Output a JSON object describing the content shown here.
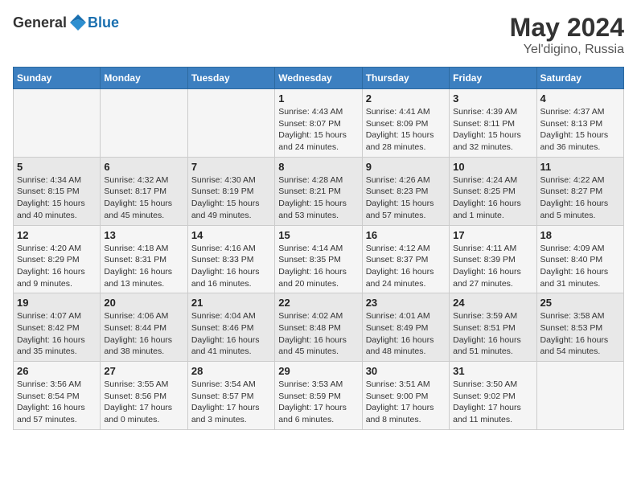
{
  "header": {
    "logo_general": "General",
    "logo_blue": "Blue",
    "month": "May 2024",
    "location": "Yel'digino, Russia"
  },
  "weekdays": [
    "Sunday",
    "Monday",
    "Tuesday",
    "Wednesday",
    "Thursday",
    "Friday",
    "Saturday"
  ],
  "weeks": [
    [
      {
        "day": "",
        "info": ""
      },
      {
        "day": "",
        "info": ""
      },
      {
        "day": "",
        "info": ""
      },
      {
        "day": "1",
        "info": "Sunrise: 4:43 AM\nSunset: 8:07 PM\nDaylight: 15 hours\nand 24 minutes."
      },
      {
        "day": "2",
        "info": "Sunrise: 4:41 AM\nSunset: 8:09 PM\nDaylight: 15 hours\nand 28 minutes."
      },
      {
        "day": "3",
        "info": "Sunrise: 4:39 AM\nSunset: 8:11 PM\nDaylight: 15 hours\nand 32 minutes."
      },
      {
        "day": "4",
        "info": "Sunrise: 4:37 AM\nSunset: 8:13 PM\nDaylight: 15 hours\nand 36 minutes."
      }
    ],
    [
      {
        "day": "5",
        "info": "Sunrise: 4:34 AM\nSunset: 8:15 PM\nDaylight: 15 hours\nand 40 minutes."
      },
      {
        "day": "6",
        "info": "Sunrise: 4:32 AM\nSunset: 8:17 PM\nDaylight: 15 hours\nand 45 minutes."
      },
      {
        "day": "7",
        "info": "Sunrise: 4:30 AM\nSunset: 8:19 PM\nDaylight: 15 hours\nand 49 minutes."
      },
      {
        "day": "8",
        "info": "Sunrise: 4:28 AM\nSunset: 8:21 PM\nDaylight: 15 hours\nand 53 minutes."
      },
      {
        "day": "9",
        "info": "Sunrise: 4:26 AM\nSunset: 8:23 PM\nDaylight: 15 hours\nand 57 minutes."
      },
      {
        "day": "10",
        "info": "Sunrise: 4:24 AM\nSunset: 8:25 PM\nDaylight: 16 hours\nand 1 minute."
      },
      {
        "day": "11",
        "info": "Sunrise: 4:22 AM\nSunset: 8:27 PM\nDaylight: 16 hours\nand 5 minutes."
      }
    ],
    [
      {
        "day": "12",
        "info": "Sunrise: 4:20 AM\nSunset: 8:29 PM\nDaylight: 16 hours\nand 9 minutes."
      },
      {
        "day": "13",
        "info": "Sunrise: 4:18 AM\nSunset: 8:31 PM\nDaylight: 16 hours\nand 13 minutes."
      },
      {
        "day": "14",
        "info": "Sunrise: 4:16 AM\nSunset: 8:33 PM\nDaylight: 16 hours\nand 16 minutes."
      },
      {
        "day": "15",
        "info": "Sunrise: 4:14 AM\nSunset: 8:35 PM\nDaylight: 16 hours\nand 20 minutes."
      },
      {
        "day": "16",
        "info": "Sunrise: 4:12 AM\nSunset: 8:37 PM\nDaylight: 16 hours\nand 24 minutes."
      },
      {
        "day": "17",
        "info": "Sunrise: 4:11 AM\nSunset: 8:39 PM\nDaylight: 16 hours\nand 27 minutes."
      },
      {
        "day": "18",
        "info": "Sunrise: 4:09 AM\nSunset: 8:40 PM\nDaylight: 16 hours\nand 31 minutes."
      }
    ],
    [
      {
        "day": "19",
        "info": "Sunrise: 4:07 AM\nSunset: 8:42 PM\nDaylight: 16 hours\nand 35 minutes."
      },
      {
        "day": "20",
        "info": "Sunrise: 4:06 AM\nSunset: 8:44 PM\nDaylight: 16 hours\nand 38 minutes."
      },
      {
        "day": "21",
        "info": "Sunrise: 4:04 AM\nSunset: 8:46 PM\nDaylight: 16 hours\nand 41 minutes."
      },
      {
        "day": "22",
        "info": "Sunrise: 4:02 AM\nSunset: 8:48 PM\nDaylight: 16 hours\nand 45 minutes."
      },
      {
        "day": "23",
        "info": "Sunrise: 4:01 AM\nSunset: 8:49 PM\nDaylight: 16 hours\nand 48 minutes."
      },
      {
        "day": "24",
        "info": "Sunrise: 3:59 AM\nSunset: 8:51 PM\nDaylight: 16 hours\nand 51 minutes."
      },
      {
        "day": "25",
        "info": "Sunrise: 3:58 AM\nSunset: 8:53 PM\nDaylight: 16 hours\nand 54 minutes."
      }
    ],
    [
      {
        "day": "26",
        "info": "Sunrise: 3:56 AM\nSunset: 8:54 PM\nDaylight: 16 hours\nand 57 minutes."
      },
      {
        "day": "27",
        "info": "Sunrise: 3:55 AM\nSunset: 8:56 PM\nDaylight: 17 hours\nand 0 minutes."
      },
      {
        "day": "28",
        "info": "Sunrise: 3:54 AM\nSunset: 8:57 PM\nDaylight: 17 hours\nand 3 minutes."
      },
      {
        "day": "29",
        "info": "Sunrise: 3:53 AM\nSunset: 8:59 PM\nDaylight: 17 hours\nand 6 minutes."
      },
      {
        "day": "30",
        "info": "Sunrise: 3:51 AM\nSunset: 9:00 PM\nDaylight: 17 hours\nand 8 minutes."
      },
      {
        "day": "31",
        "info": "Sunrise: 3:50 AM\nSunset: 9:02 PM\nDaylight: 17 hours\nand 11 minutes."
      },
      {
        "day": "",
        "info": ""
      }
    ]
  ]
}
